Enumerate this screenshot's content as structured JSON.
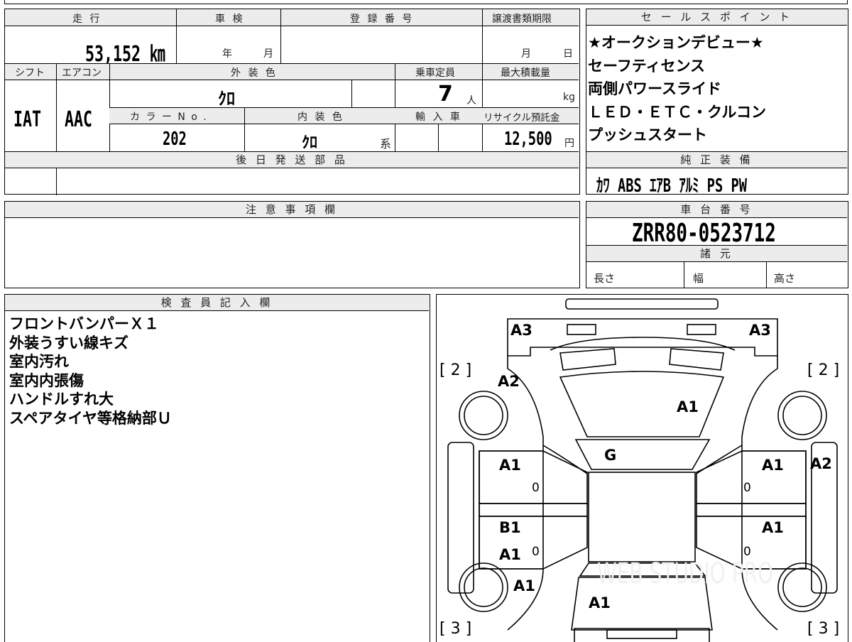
{
  "top": {
    "mileage_header": "走 行",
    "shaken_header": "車 検",
    "registration_header": "登 録 番 号",
    "transfer_deadline_header": "譲渡書類期限",
    "mileage_value": "53,152 ㎞",
    "shaken_year_unit": "年",
    "shaken_month_unit": "月",
    "transfer_month_unit": "月",
    "transfer_day_unit": "日",
    "shift_header": "シフト",
    "aircon_header": "エアコン",
    "exterior_color_header": "外 装 色",
    "capacity_header": "乗車定員",
    "max_load_header": "最大積載量",
    "exterior_color_value": "ｸﾛ",
    "capacity_value": "7",
    "capacity_unit": "人",
    "max_load_unit": "kg",
    "shift_value": "IAT",
    "aircon_value": "AAC",
    "color_no_header": "カ ラ ー N o .",
    "interior_color_header": "内 装 色",
    "import_header": "輸 入 車",
    "recycle_header": "リサイクル預託金",
    "color_no_value": "202",
    "interior_color_value": "ｸﾛ",
    "interior_color_suffix": "系",
    "recycle_value": "12,500",
    "recycle_unit": "円",
    "later_parts_header": "後 日 発 送 部 品"
  },
  "sales_points": {
    "header": "セ ー ル ス ポ イ ン ト",
    "lines": [
      "★オークションデビュー★",
      "セーフティセンス",
      "両側パワースライド",
      "ＬＥＤ・ＥＴＣ・クルコン",
      "プッシュスタート"
    ]
  },
  "equipment": {
    "header": "純 正 装 備",
    "value": "ｶﾜ  ABS  ｴｱB  ｱﾙﾐ  PS  PW"
  },
  "notes": {
    "header": "注 意 事 項 欄"
  },
  "chassis": {
    "header": "車 台 番 号",
    "value": "ZRR80-0523712",
    "specs_header": "諸 元",
    "length_label": "長さ",
    "width_label": "幅",
    "height_label": "高さ"
  },
  "inspector": {
    "header": "検 査 員 記 入 欄",
    "lines": [
      "フロントバンパーＸ１",
      "外装うすい線キズ",
      "室内汚れ",
      "室内内張傷",
      "ハンドルすれ大",
      "スペアタイヤ等格納部Ｕ"
    ]
  },
  "diagram": {
    "marks": {
      "front_left_corner": "A3",
      "front_right_corner": "A3",
      "front_left_fender": "A2",
      "hood": "A1",
      "windshield": "G",
      "left_front_door": "A1",
      "right_front_door": "A1",
      "right_fender": "A2",
      "left_rear_door_1": "B1",
      "left_rear_door_2": "A1",
      "right_rear_door": "A1",
      "left_quarter": "A1",
      "rear": "A1"
    },
    "small_marks": {
      "left_front": "0",
      "left_rear": "0",
      "right_front": "0",
      "right_rear": "0"
    },
    "brackets": {
      "top_left": "[ 2 ]",
      "top_right": "[ 2 ]",
      "bottom_left": "[ 3 ]",
      "bottom_right": "[ 3 ]"
    },
    "watermark": "WEB STUDIO PRO"
  }
}
